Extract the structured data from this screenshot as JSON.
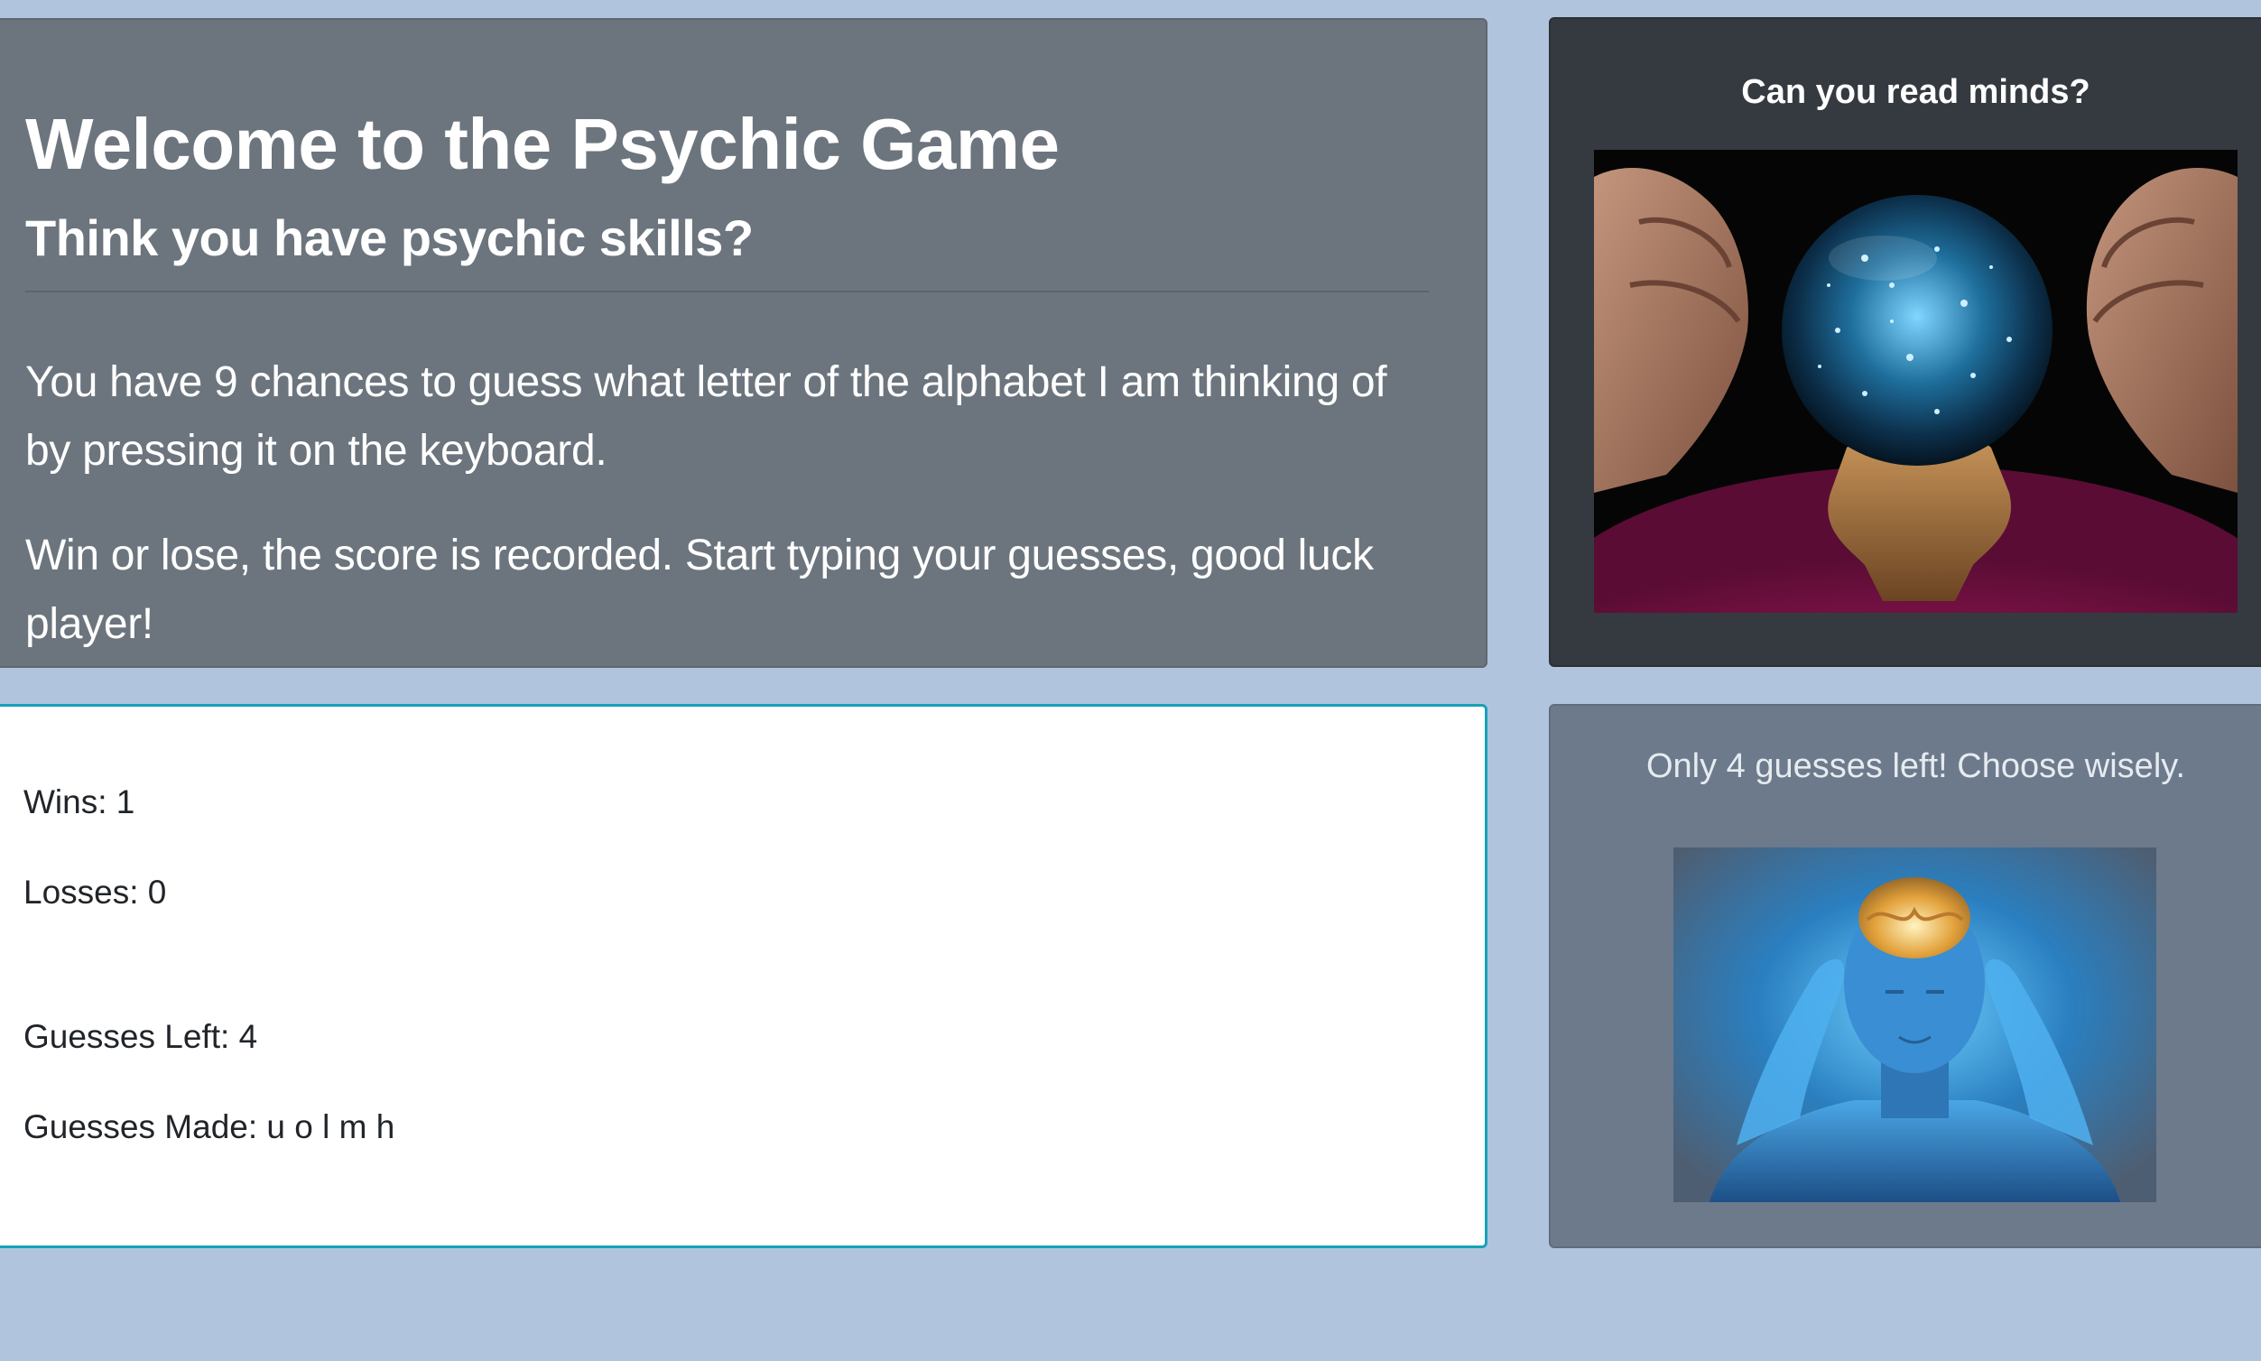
{
  "intro": {
    "heading": "Welcome to the Psychic Game",
    "subheading": "Think you have psychic skills?",
    "paragraph1": "You have 9 chances to guess what letter of the alphabet I am thinking of by pressing it on the keyboard.",
    "paragraph2": "Win or lose, the score is recorded. Start typing your guesses, good luck player!"
  },
  "mind_card": {
    "title": "Can you read minds?",
    "image": "crystal-ball-image"
  },
  "score": {
    "wins_label": "Wins: 1",
    "losses_label": "Losses: 0",
    "guesses_left_label": "Guesses Left: 4",
    "guesses_made_label": "Guesses Made: u o l m h"
  },
  "hint_card": {
    "message": "Only 4 guesses left! Choose wisely.",
    "image": "glowing-head-image"
  },
  "colors": {
    "page_background": "#b0c4de",
    "intro_background": "#6c757d",
    "mind_card_background": "#343a40",
    "score_border": "#17a2b8",
    "hint_card_background": "#6c7a8c"
  }
}
